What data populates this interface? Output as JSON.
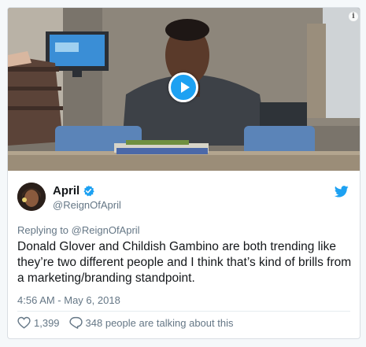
{
  "tweet": {
    "display_name": "April",
    "handle": "@ReignOfApril",
    "verified": true,
    "reply_prefix": "Replying to",
    "reply_to": "@ReignOfApril",
    "text": "Donald Glover and Childish Gambino are both trending like they’re two different people and I think that’s kind of brills from a marketing/branding standpoint.",
    "timestamp": "4:56 AM - May 6, 2018",
    "likes": "1,399",
    "replies_text": "348 people are talking about this"
  },
  "media": {
    "type": "video",
    "info_symbol": "i"
  },
  "colors": {
    "accent": "#1da1f2",
    "text": "#14171a",
    "muted": "#657786"
  },
  "icons": [
    "play-icon",
    "info-icon",
    "verified-icon",
    "twitter-bird-icon",
    "heart-icon",
    "reply-bubble-icon"
  ]
}
